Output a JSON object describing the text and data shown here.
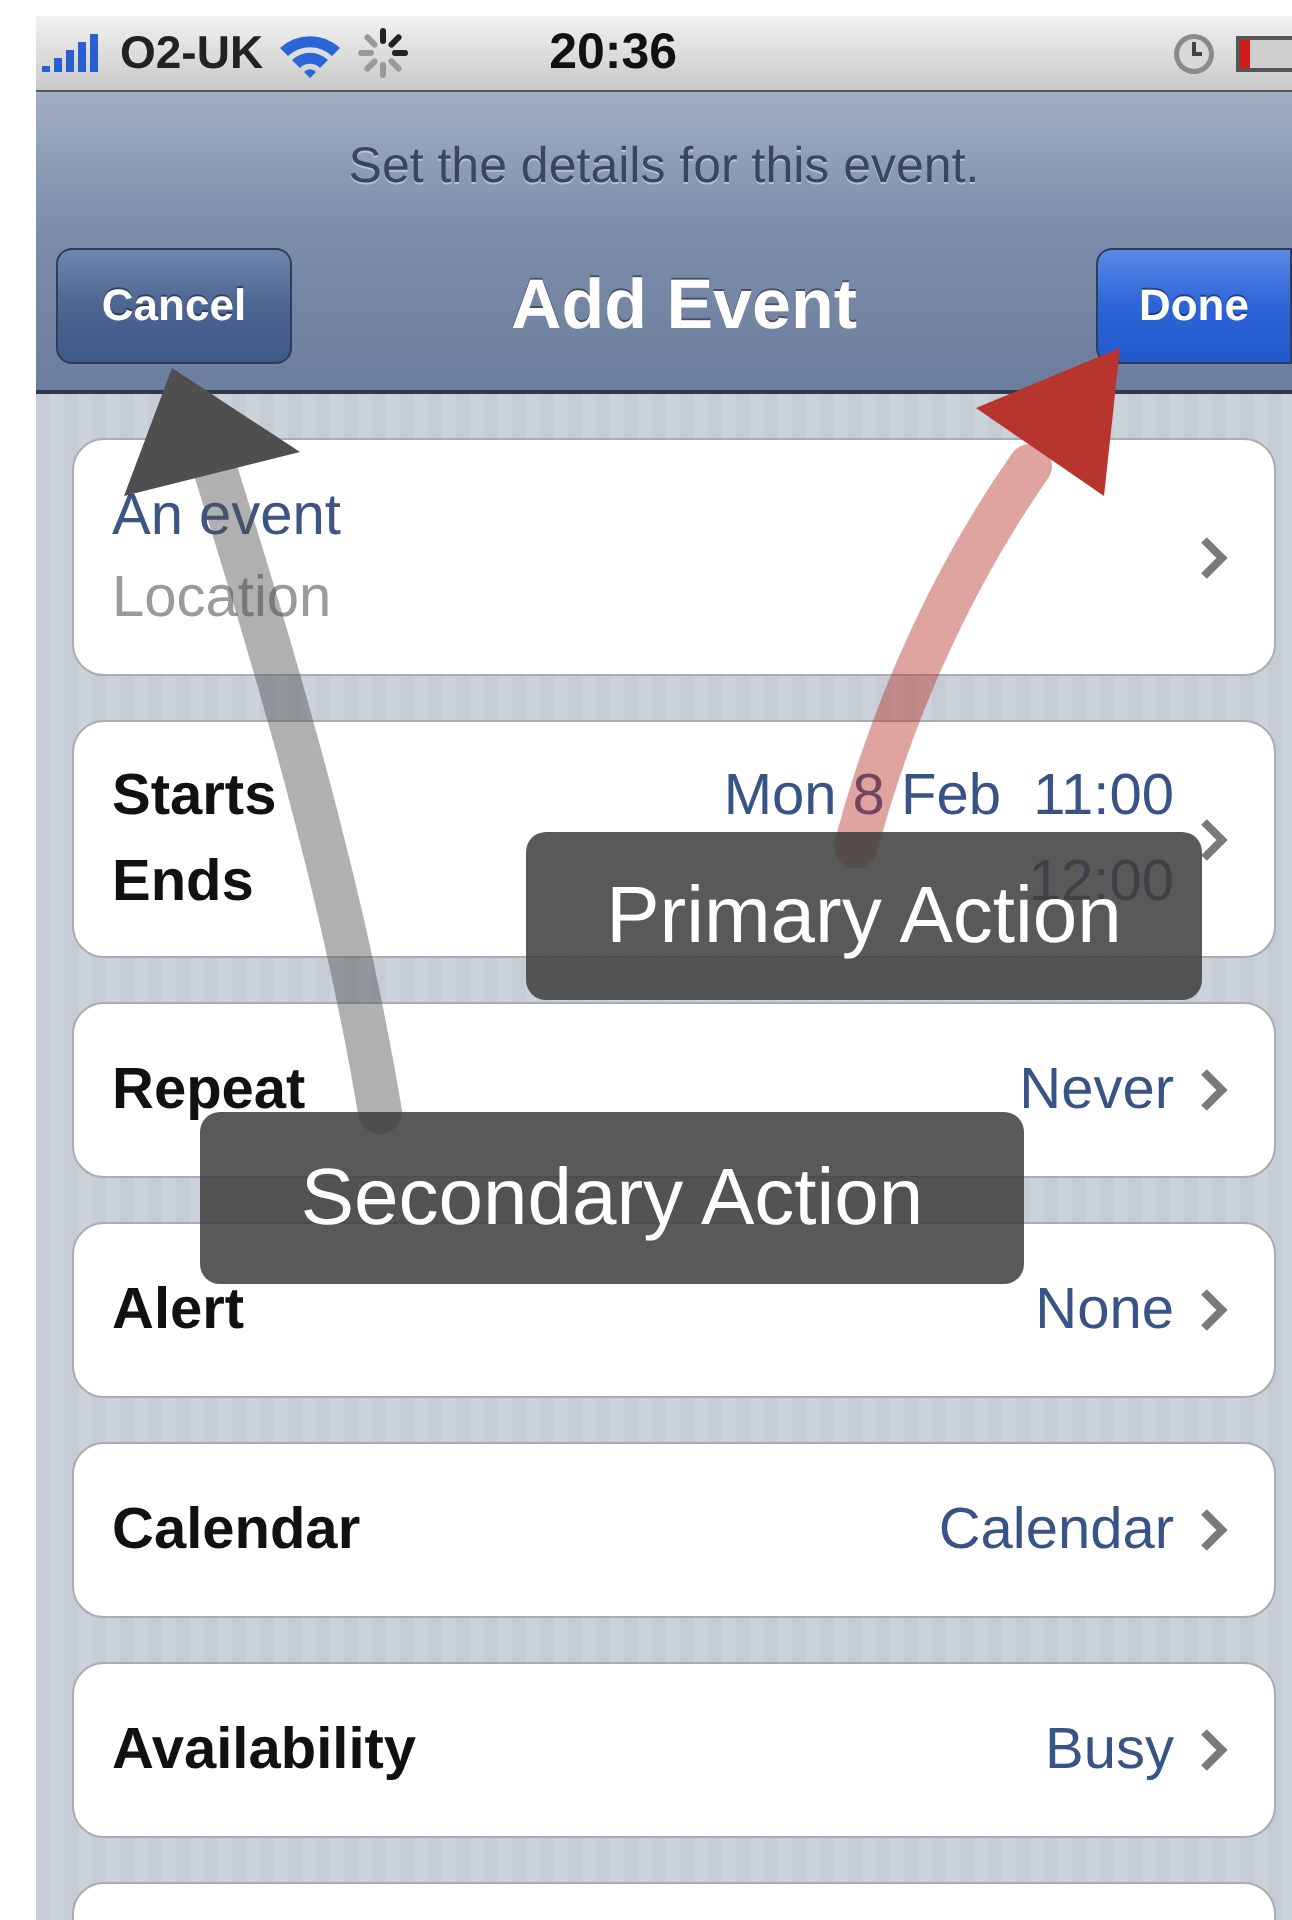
{
  "status_bar": {
    "carrier": "O2-UK",
    "time": "20:36"
  },
  "nav_bar": {
    "prompt": "Set the details for this event.",
    "title": "Add Event",
    "left_button": "Cancel",
    "right_button": "Done"
  },
  "groups": [
    {
      "kind": "title",
      "title": "An event",
      "location": "Location"
    },
    {
      "kind": "dates",
      "rows": [
        {
          "label": "Starts",
          "value": "Mon 8 Feb  11:00"
        },
        {
          "label": "Ends",
          "value": "12:00"
        }
      ]
    },
    {
      "kind": "row",
      "label": "Repeat",
      "value": "Never"
    },
    {
      "kind": "row",
      "label": "Alert",
      "value": "None"
    },
    {
      "kind": "row",
      "label": "Calendar",
      "value": "Calendar"
    },
    {
      "kind": "row",
      "label": "Availability",
      "value": "Busy"
    }
  ],
  "annotations": [
    {
      "kind": "primary",
      "text": "Primary Action",
      "color": "#b8352d"
    },
    {
      "kind": "secondary",
      "text": "Secondary Action",
      "color": "#4f4f4f"
    }
  ]
}
